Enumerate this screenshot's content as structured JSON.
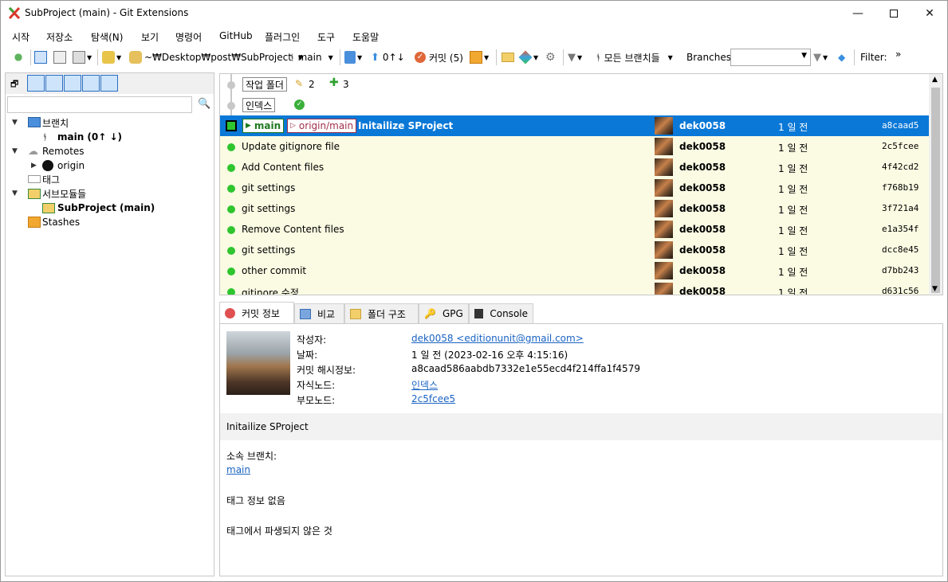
{
  "window": {
    "title": "SubProject (main) - Git Extensions"
  },
  "menu": [
    "시작",
    "저장소",
    "탐색(N)",
    "보기",
    "명령어",
    "GitHub",
    "플러그인",
    "도구",
    "도움말"
  ],
  "toolbar": {
    "repo_path": "~₩Desktop₩post₩SubProject",
    "branch": "main",
    "push_pull": "0↑↓",
    "commit_label": "커밋 (5)",
    "branch_filter": "모든 브랜치들",
    "branches_label": "Branches:",
    "filter_label": "Filter:",
    "more": "»"
  },
  "sidebar": {
    "search_placeholder": "",
    "branches_label": "브랜치",
    "branch_main": "main (0↑ ↓)",
    "remotes_label": "Remotes",
    "remote_origin": "origin",
    "tags_label": "태그",
    "submodules_label": "서브모듈들",
    "submodule_item": "SubProject (main)",
    "stashes_label": "Stashes"
  },
  "grid": {
    "worktree_label": "작업 폴더",
    "worktree_modified": "2",
    "worktree_added": "3",
    "index_label": "인덱스",
    "selected": {
      "branch_tag": "main",
      "remote_tag": "origin/main",
      "message": "Initailize SProject",
      "author": "dek0058",
      "date": "1 일 전",
      "hash": "a8caad5"
    },
    "commits": [
      {
        "message": "Update gitignore file",
        "author": "dek0058",
        "date": "1 일 전",
        "hash": "2c5fcee"
      },
      {
        "message": "Add Content files",
        "author": "dek0058",
        "date": "1 일 전",
        "hash": "4f42cd2"
      },
      {
        "message": "git settings",
        "author": "dek0058",
        "date": "1 일 전",
        "hash": "f768b19"
      },
      {
        "message": "git settings",
        "author": "dek0058",
        "date": "1 일 전",
        "hash": "3f721a4"
      },
      {
        "message": "Remove Content files",
        "author": "dek0058",
        "date": "1 일 전",
        "hash": "e1a354f"
      },
      {
        "message": "git settings",
        "author": "dek0058",
        "date": "1 일 전",
        "hash": "dcc8e45"
      },
      {
        "message": "other commit",
        "author": "dek0058",
        "date": "1 일 전",
        "hash": "d7bb243"
      },
      {
        "message": "gitinore 수정",
        "author": "dek0058",
        "date": "1 일 전",
        "hash": "d631c56"
      }
    ]
  },
  "tabs": [
    "커밋 정보",
    "비교",
    "폴더 구조",
    "GPG",
    "Console"
  ],
  "details": {
    "author_label": "작성자:",
    "author_value": "dek0058 <editionunit@gmail.com>",
    "date_label": "날짜:",
    "date_value": "1 일 전 (2023-02-16 오후 4:15:16)",
    "hash_label": "커밋 해시정보:",
    "hash_value": "a8caad586aabdb7332e1e55ecd4f214ffa1f4579",
    "child_label": "자식노드:",
    "child_value": "인덱스",
    "parent_label": "부모노드:",
    "parent_value": "2c5fcee5",
    "message": "Initailize SProject",
    "contained_label": "소속 브랜치:",
    "contained_value": "main",
    "tags_info": "태그 정보 없음",
    "not_derived": "태그에서 파생되지 않은 것"
  },
  "colors": {
    "selected": "#0a78d7",
    "graph": "#2ec52e",
    "row_bg": "#fbfbe3",
    "link": "#1a63c2"
  }
}
